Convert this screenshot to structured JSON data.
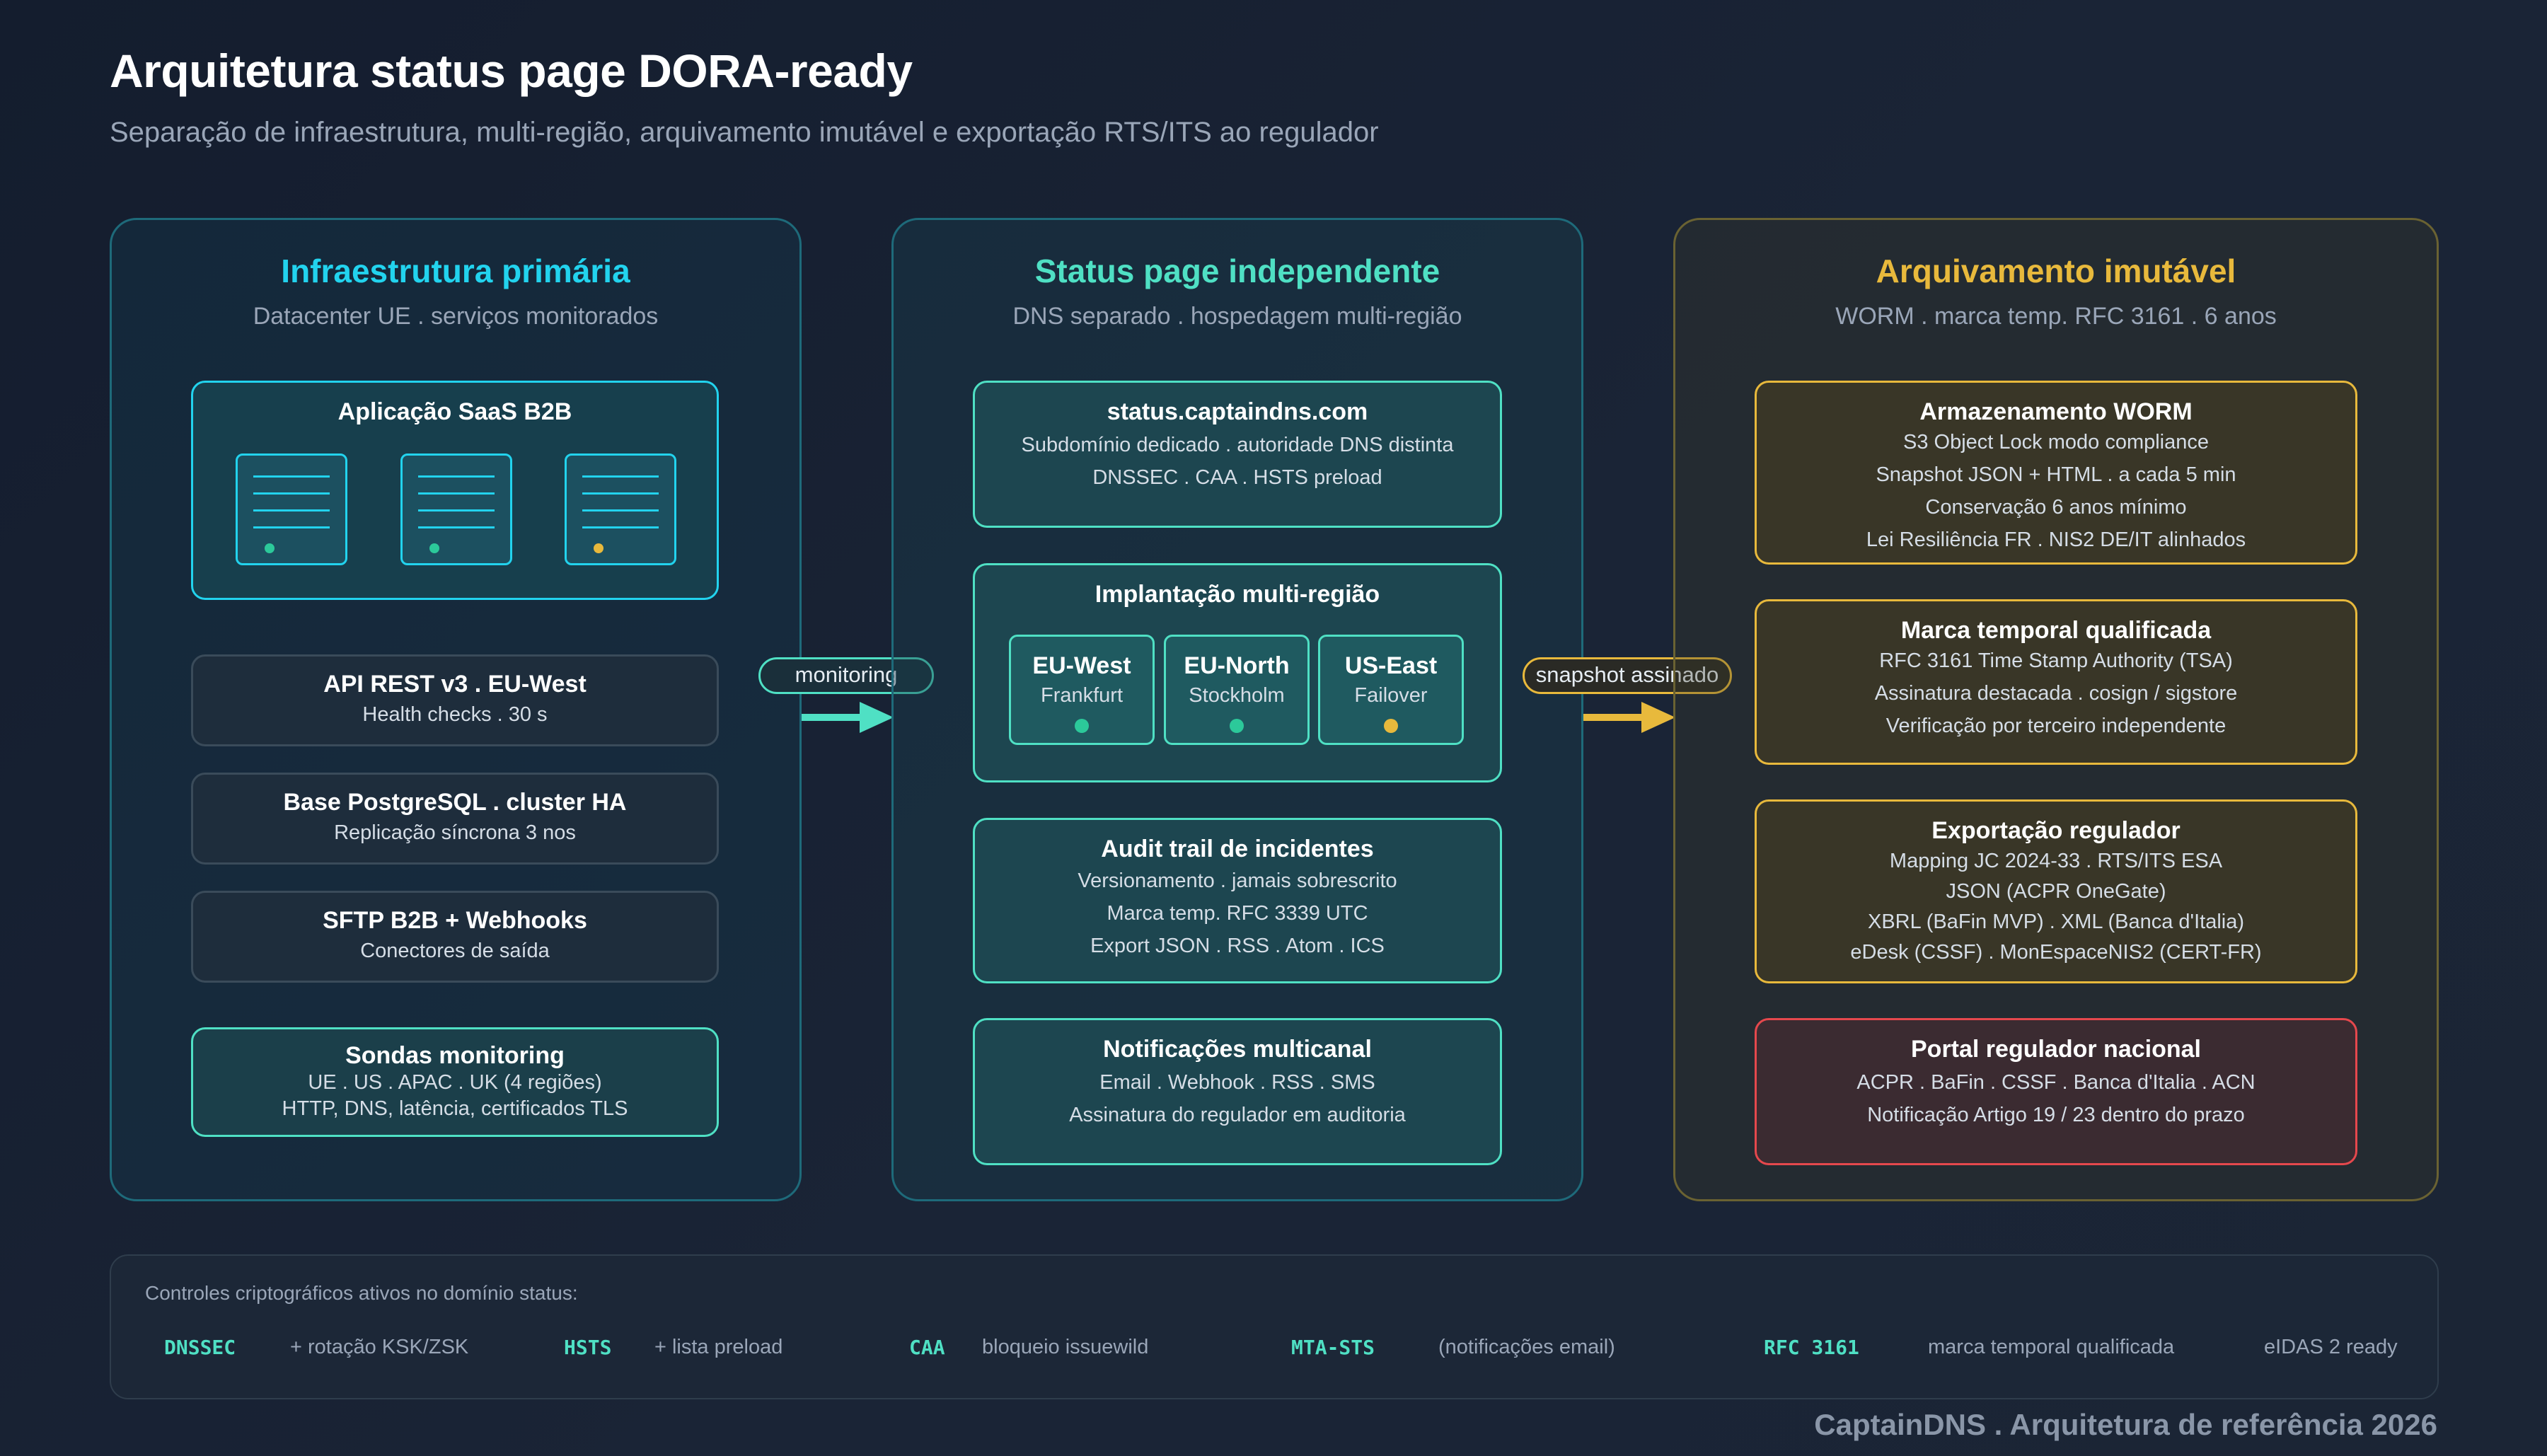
{
  "header": {
    "title": "Arquitetura status page DORA-ready",
    "subtitle": "Separação de infraestrutura, multi-região, arquivamento imutável e exportação RTS/ITS ao regulador"
  },
  "colors": {
    "cyan": "#22d3ee",
    "teal": "#4fe0c4",
    "gold": "#e8b93c",
    "red": "#e5484d",
    "green_dot": "#2cc99a",
    "amber_dot": "#e8b93c"
  },
  "primary": {
    "title": "Infraestrutura primária",
    "subtitle": "Datacenter UE . serviços monitorados",
    "saas": {
      "title": "Aplicação SaaS B2B",
      "server_status": [
        "green",
        "green",
        "amber"
      ]
    },
    "api": {
      "title": "API REST v3 . EU-West",
      "line": "Health checks . 30 s"
    },
    "db": {
      "title": "Base PostgreSQL . cluster HA",
      "line": "Replicação síncrona 3 nos"
    },
    "sftp": {
      "title": "SFTP B2B + Webhooks",
      "line": "Conectores de saída"
    },
    "probes": {
      "title": "Sondas monitoring",
      "lines": [
        "UE . US . APAC . UK (4 regiões)",
        "HTTP, DNS, latência, certificados TLS"
      ]
    }
  },
  "connectors": {
    "monitoring": "monitoring",
    "snapshot": "snapshot assinado"
  },
  "status_page": {
    "title": "Status page independente",
    "subtitle": "DNS separado . hospedagem multi-região",
    "domain": {
      "title": "status.captaindns.com",
      "lines": [
        "Subdomínio dedicado . autoridade DNS distinta",
        "DNSSEC . CAA . HSTS preload"
      ]
    },
    "multi_region": {
      "title": "Implantação multi-região",
      "regions": [
        {
          "name": "EU-West",
          "city": "Frankfurt",
          "status": "green"
        },
        {
          "name": "EU-North",
          "city": "Stockholm",
          "status": "green"
        },
        {
          "name": "US-East",
          "city": "Failover",
          "status": "amber"
        }
      ]
    },
    "audit": {
      "title": "Audit trail de incidentes",
      "lines": [
        "Versionamento . jamais sobrescrito",
        "Marca temp. RFC 3339 UTC",
        "Export JSON . RSS . Atom . ICS"
      ]
    },
    "notify": {
      "title": "Notificações multicanal",
      "lines": [
        "Email . Webhook . RSS . SMS",
        "Assinatura do regulador em auditoria"
      ]
    }
  },
  "archive": {
    "title": "Arquivamento imutável",
    "subtitle": "WORM . marca temp. RFC 3161 . 6 anos",
    "worm": {
      "title": "Armazenamento WORM",
      "lines": [
        "S3 Object Lock modo compliance",
        "Snapshot JSON + HTML . a cada 5 min",
        "Conservação 6 anos mínimo",
        "Lei Resiliência FR . NIS2 DE/IT alinhados"
      ]
    },
    "timestamp": {
      "title": "Marca temporal qualificada",
      "lines": [
        "RFC 3161 Time Stamp Authority (TSA)",
        "Assinatura destacada . cosign / sigstore",
        "Verificação por terceiro independente"
      ]
    },
    "export": {
      "title": "Exportação regulador",
      "lines": [
        "Mapping JC 2024-33 . RTS/ITS ESA",
        "JSON (ACPR OneGate)",
        "XBRL (BaFin MVP) . XML (Banca d'Italia)",
        "eDesk (CSSF) . MonEspaceNIS2 (CERT-FR)"
      ]
    },
    "portal": {
      "title": "Portal regulador nacional",
      "lines": [
        "ACPR . BaFin . CSSF . Banca d'Italia . ACN",
        "Notificação Artigo 19 / 23 dentro do prazo"
      ]
    }
  },
  "footer": {
    "caption": "Controles criptográficos ativos no domínio status:",
    "controls": [
      {
        "code": "DNSSEC",
        "note": "+ rotação KSK/ZSK"
      },
      {
        "code": "HSTS",
        "note": "+ lista preload"
      },
      {
        "code": "CAA",
        "note": "bloqueio issuewild"
      },
      {
        "code": "MTA-STS",
        "note": "(notificações email)"
      },
      {
        "code": "RFC 3161",
        "note": "marca temporal qualificada"
      }
    ],
    "extra": "eIDAS 2 ready"
  },
  "credit": "CaptainDNS . Arquitetura de referência 2026"
}
